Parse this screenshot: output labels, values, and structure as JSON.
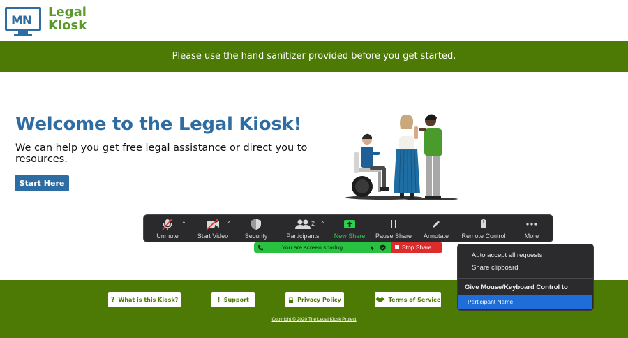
{
  "logo": {
    "mark": "MN",
    "line1": "Legal",
    "line2": "Kiosk"
  },
  "banner": {
    "text": "Please use the hand sanitizer provided before you get started."
  },
  "main": {
    "title": "Welcome to the Legal Kiosk!",
    "subtitle": "We can help you get free legal assistance or direct you to resources.",
    "start_label": "Start Here"
  },
  "zoom": {
    "unmute": "Unmute",
    "start_video": "Start Video",
    "security": "Security",
    "participants": "Participants",
    "participant_count": "2",
    "new_share": "New Share",
    "pause_share": "Pause Share",
    "annotate": "Annotate",
    "remote_control": "Remote Control",
    "more": "More",
    "sharing_text": "You are screen sharing",
    "stop_share": "Stop Share",
    "accent_green": "#2ad14b",
    "stop_red": "#dd2c2c"
  },
  "more_menu": {
    "auto_accept": "Auto accept all requests",
    "share_clipboard": "Share clipboard",
    "give_control_header": "Give Mouse/Keyboard Control to",
    "participant_name": "Participant Name"
  },
  "footer": {
    "what_is": "What is this Kiosk?",
    "support": "Support",
    "privacy": "Privacy Policy",
    "terms": "Terms of Service",
    "copyright": "Copyright © 2020 The Legal Kiosk Project"
  },
  "colors": {
    "brand_green": "#4c7a05",
    "brand_blue": "#2e6da4"
  }
}
